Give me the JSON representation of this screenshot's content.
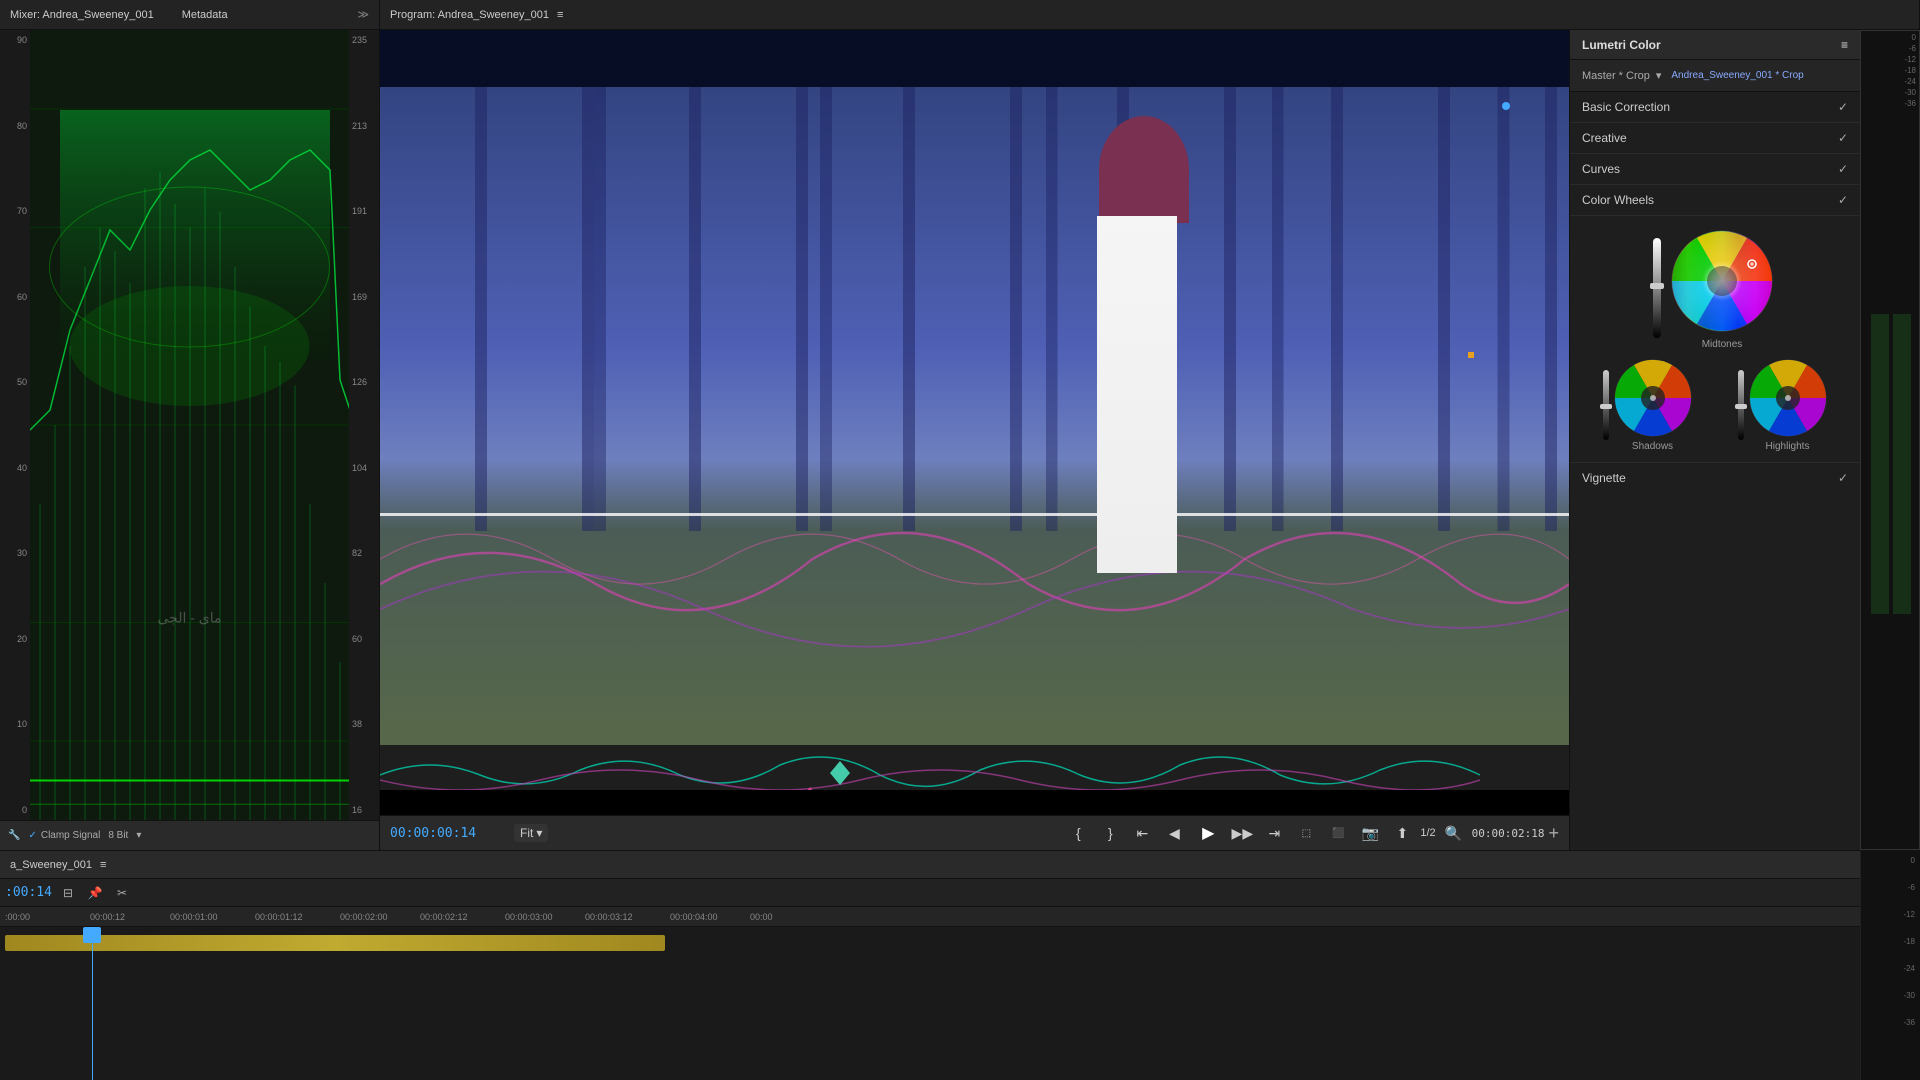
{
  "panels": {
    "left": {
      "title": "Mixer: Andrea_Sweeney_001",
      "metadata": "Metadata",
      "waveform": {
        "left_labels": [
          "0",
          "10",
          "20",
          "30",
          "40",
          "50",
          "60",
          "70",
          "80",
          "90"
        ],
        "right_labels": [
          "16",
          "38",
          "60",
          "82",
          "104",
          "126",
          "169",
          "191",
          "213",
          "235"
        ],
        "clamp_signal": "Clamp Signal",
        "bit_depth": "8 Bit"
      }
    },
    "center": {
      "title": "Program: Andrea_Sweeney_001",
      "timecode_current": "00:00:00:14",
      "fit_label": "Fit",
      "fraction": "1/2",
      "timecode_end": "00:00:02:18",
      "controls": {
        "rewind": "⏮",
        "step_back": "◀",
        "play": "▶",
        "step_forward": "▶",
        "fast_forward": "⏭"
      }
    },
    "right": {
      "title": "Lumetri Color",
      "master_crop": "Master * Crop",
      "clip_name": "Andrea_Sweeney_001 * Crop",
      "sections": [
        {
          "label": "Basic Correction",
          "checked": true
        },
        {
          "label": "Creative",
          "checked": true
        },
        {
          "label": "Curves",
          "checked": true
        },
        {
          "label": "Color Wheels",
          "checked": true
        }
      ],
      "wheels": {
        "midtones_label": "Midtones",
        "shadows_label": "Shadows",
        "highlights_label": "Highlights"
      },
      "vignette": "Vignette",
      "meter_labels": [
        "0",
        "-6",
        "-12",
        "-18",
        "-24",
        "-30",
        "-36"
      ]
    }
  },
  "timeline": {
    "sequence_name": "a_Sweeney_001",
    "hamburger": "≡",
    "current_time": "00:14",
    "timestamps": [
      ":00:00",
      "00:00:12",
      "00:00:01:00",
      "00:00:01:12",
      "00:00:02:00",
      "00:00:02:12",
      "00:00:03:00",
      "00:00:03:12",
      "00:00:04:00",
      "00:00"
    ]
  },
  "icons": {
    "wrench": "⚙",
    "expand": "≫",
    "hamburger": "≡",
    "dropdown": "▾",
    "magnifier": "🔍",
    "plus": "+",
    "marker_in": "{",
    "marker_out": "}",
    "step_back": "⇤",
    "shuttle_back": "◀",
    "play": "▶",
    "shuttle_fwd": "▶",
    "step_fwd": "⇥",
    "export": "⬆",
    "camera": "📷",
    "insert": "⬚",
    "lift": "⬛"
  }
}
